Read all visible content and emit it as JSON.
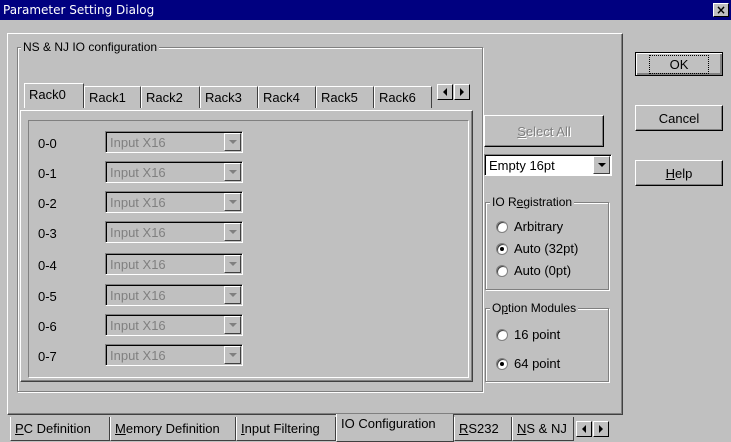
{
  "window": {
    "title": "Parameter Setting Dialog",
    "close_label": "×"
  },
  "main_group": {
    "label": "NS & NJ IO configuration"
  },
  "rack_tabs": [
    {
      "label": "Rack0",
      "selected": true
    },
    {
      "label": "Rack1"
    },
    {
      "label": "Rack2"
    },
    {
      "label": "Rack3"
    },
    {
      "label": "Rack4"
    },
    {
      "label": "Rack5"
    },
    {
      "label": "Rack6"
    }
  ],
  "slots": [
    {
      "label": "0-0",
      "value": "Input X16"
    },
    {
      "label": "0-1",
      "value": "Input X16"
    },
    {
      "label": "0-2",
      "value": "Input X16"
    },
    {
      "label": "0-3",
      "value": "Input X16"
    },
    {
      "label": "0-4",
      "value": "Input X16"
    },
    {
      "label": "0-5",
      "value": "Input X16"
    },
    {
      "label": "0-6",
      "value": "Input X16"
    },
    {
      "label": "0-7",
      "value": "Input X16"
    }
  ],
  "select_all": {
    "pre": "",
    "accel": "S",
    "post": "elect All"
  },
  "module_select": {
    "value": "Empty 16pt"
  },
  "io_registration": {
    "label_pre": "IO R",
    "label_accel": "e",
    "label_post": "gistration",
    "options": [
      {
        "label": "Arbitrary",
        "checked": false
      },
      {
        "label": "Auto (32pt)",
        "checked": true
      },
      {
        "label": "Auto (0pt)",
        "checked": false
      }
    ]
  },
  "option_modules": {
    "label_pre": "O",
    "label_accel": "p",
    "label_post": "tion Modules",
    "options": [
      {
        "label": "16 point",
        "checked": false
      },
      {
        "label": "64 point",
        "checked": true
      }
    ]
  },
  "buttons": {
    "ok": "OK",
    "cancel": "Cancel",
    "help_accel": "H",
    "help_rest": "elp"
  },
  "bottom_tabs": [
    {
      "accel": "P",
      "rest": "C Definition"
    },
    {
      "accel": "M",
      "rest": "emory Definition"
    },
    {
      "accel": "I",
      "rest": "nput Filtering"
    },
    {
      "accel": "",
      "rest": "IO Configuration",
      "selected": true
    },
    {
      "accel": "R",
      "rest": "S232"
    },
    {
      "accel": "N",
      "rest": "S & NJ"
    }
  ]
}
